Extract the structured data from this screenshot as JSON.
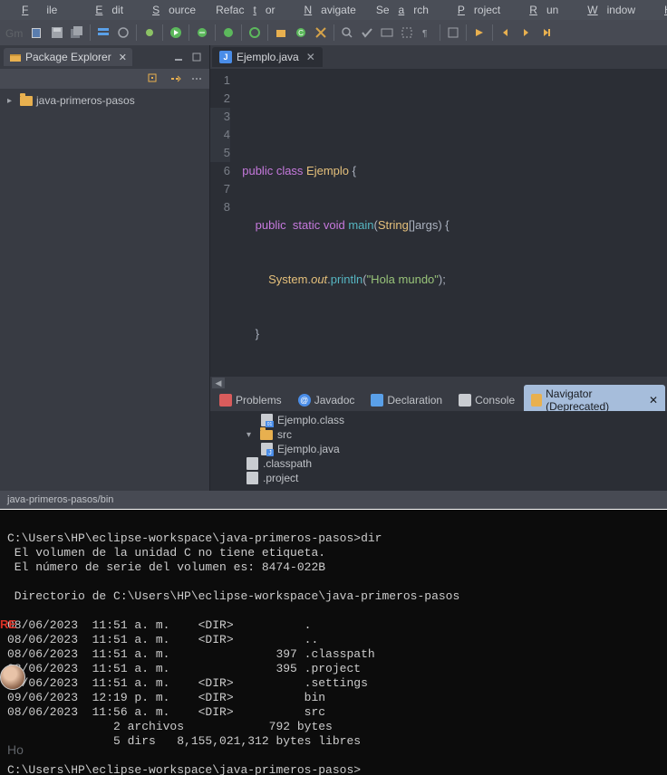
{
  "menu": [
    "File",
    "Edit",
    "Source",
    "Refactor",
    "Navigate",
    "Search",
    "Project",
    "Run",
    "Window",
    "Help"
  ],
  "gm_label": "Gm",
  "package_explorer": {
    "title": "Package Explorer",
    "project": "java-primeros-pasos"
  },
  "editor": {
    "tab": "Ejemplo.java",
    "line_numbers": [
      "1",
      "2",
      "3",
      "4",
      "5",
      "6",
      "7",
      "8"
    ]
  },
  "code": {
    "l2a": "public ",
    "l2b": "class ",
    "l2c": "Ejemplo ",
    "l2d": "{",
    "l3a": "public  ",
    "l3b": "static ",
    "l3c": "void ",
    "l3d": "main",
    "l3e": "(",
    "l3f": "String",
    "l3g": "[]",
    "l3h": "args",
    "l3i": ") {",
    "l4a": "System",
    "l4b": ".",
    "l4c": "out",
    "l4d": ".",
    "l4e": "println",
    "l4f": "(",
    "l4g": "\"Hola mundo\"",
    "l4h": ");",
    "l5": "}",
    "l7": "}"
  },
  "bottom_tabs": {
    "problems": "Problems",
    "javadoc": "Javadoc",
    "declaration": "Declaration",
    "console": "Console",
    "navigator": "Navigator (Deprecated)"
  },
  "navigator": {
    "items": [
      "Ejemplo.class",
      "src",
      "Ejemplo.java",
      ".classpath",
      ".project"
    ]
  },
  "statusbar": "java-primeros-pasos/bin",
  "terminal_lines": [
    "",
    "C:\\Users\\HP\\eclipse-workspace\\java-primeros-pasos>dir",
    " El volumen de la unidad C no tiene etiqueta.",
    " El número de serie del volumen es: 8474-022B",
    "",
    " Directorio de C:\\Users\\HP\\eclipse-workspace\\java-primeros-pasos",
    "",
    "08/06/2023  11:51 a. m.    <DIR>          .",
    "08/06/2023  11:51 a. m.    <DIR>          ..",
    "08/06/2023  11:51 a. m.               397 .classpath",
    "08/06/2023  11:51 a. m.               395 .project",
    "08/06/2023  11:51 a. m.    <DIR>          .settings",
    "09/06/2023  12:19 p. m.    <DIR>          bin",
    "08/06/2023  11:56 a. m.    <DIR>          src",
    "               2 archivos            792 bytes",
    "               5 dirs   8,155,021,312 bytes libres",
    "",
    "C:\\Users\\HP\\eclipse-workspace\\java-primeros-pasos>"
  ],
  "sidebar_extras": {
    "recent": "RE",
    "hola": "Ho"
  }
}
